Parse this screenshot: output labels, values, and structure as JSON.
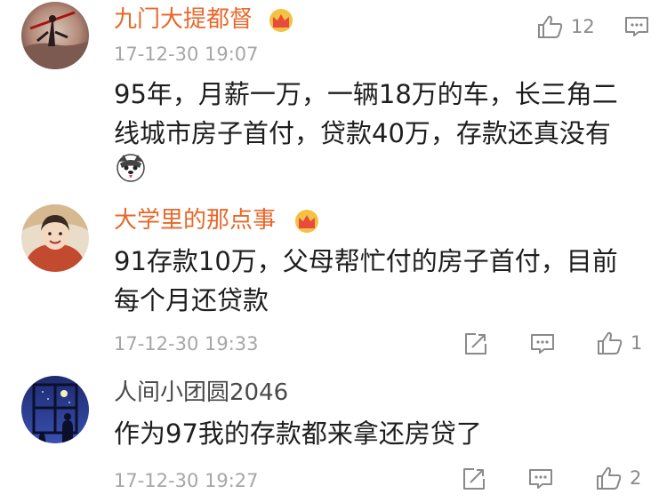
{
  "comments": [
    {
      "username": "九门大提都督",
      "time": "17-12-30 19:07",
      "lines": [
        "95年，月薪一万，一辆18万的车，长三角二",
        "线城市房子首付，贷款40万，存款还真没有"
      ],
      "likes": "12",
      "vip": true
    },
    {
      "username": "大学里的那点事",
      "lines": [
        "91存款10万，父母帮忙付的房子首付，目前",
        "每个月还贷款"
      ],
      "time": "17-12-30 19:33",
      "likes": "1",
      "vip": true
    },
    {
      "username": "人间小团圆2046",
      "lines": [
        "作为97我的存款都来拿还房贷了"
      ],
      "time": "17-12-30 19:27",
      "likes": "2",
      "vip": false
    }
  ],
  "icons": {
    "like": "thumbs-up-icon",
    "comment": "comment-icon",
    "repost": "repost-icon",
    "vip_badge": "crown-icon",
    "emoji": "husky-dog-emoji"
  },
  "colors": {
    "vip_name": "#e8672a",
    "normal_name": "#4a4a4a",
    "timestamp": "#a6a6a6",
    "icon": "#8a8a8a"
  }
}
